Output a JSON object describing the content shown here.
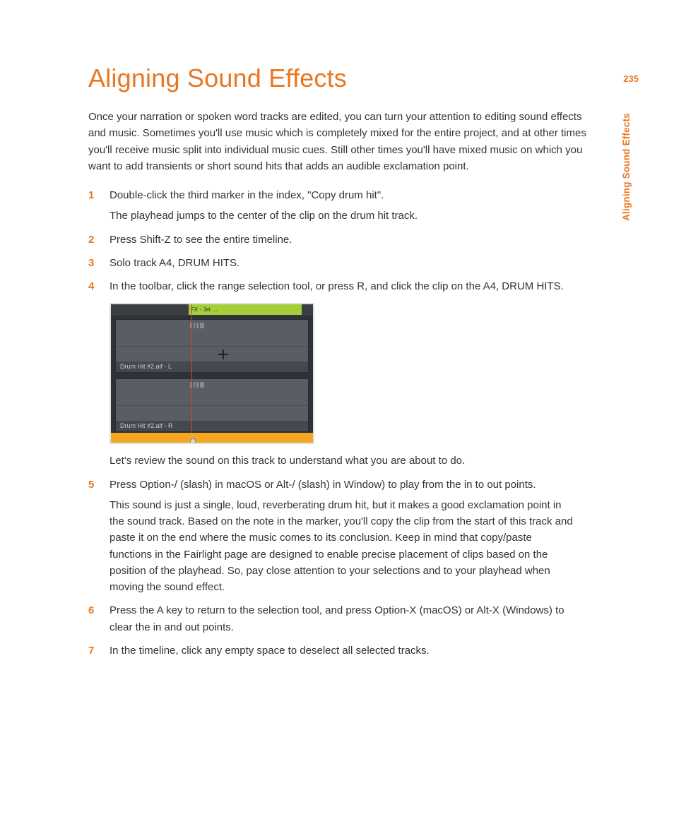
{
  "page_number": "235",
  "side_label": "Aligning Sound Effects",
  "title": "Aligning Sound Effects",
  "intro": "Once your narration or spoken word tracks are edited, you can turn your attention to editing sound effects and music. Sometimes you'll use music which is completely mixed for the entire project, and at other times you'll receive music split into individual music cues. Still other times you'll have mixed music on which you want to add transients or short sound hits that adds an audible exclamation point.",
  "steps": {
    "s1": {
      "main": "Double-click the third marker in the index, \"Copy drum hit\".",
      "sub": "The playhead jumps to the center of the clip on the drum hit track."
    },
    "s2": {
      "main": "Press Shift-Z to see the entire timeline."
    },
    "s3": {
      "main": "Solo track A4, DRUM HITS."
    },
    "s4": {
      "main": "In the toolbar, click the range selection tool, or press R, and click the clip on the A4, DRUM HITS.",
      "after": "Let's review the sound on this track to understand what you are about to do."
    },
    "s5": {
      "main": "Press Option-/ (slash) in macOS or Alt-/ (slash) in Window) to play from the in to out points.",
      "sub": "This sound is just a single, loud, reverberating drum hit, but it makes a good exclamation point in the sound track. Based on the note in the marker, you'll copy the clip from the start of this track and paste it on the end where the music comes to its conclusion. Keep in mind that copy/paste functions in the Fairlight page are designed to enable precise placement of clips based on the position of the playhead. So, pay close attention to your selections and to your playhead when moving the sound effect."
    },
    "s6": {
      "main": "Press the A key to return to the selection tool, and press Option-X (macOS) or Alt-X (Windows) to clear the in and out points."
    },
    "s7": {
      "main": "In the timeline, click any empty space to deselect all selected tracks."
    }
  },
  "screenshot": {
    "clip_label": "FX - Jet …",
    "track1_label": "Drum Hit #2.aif - L",
    "track2_label": "Drum Hit #2.aif - R"
  }
}
